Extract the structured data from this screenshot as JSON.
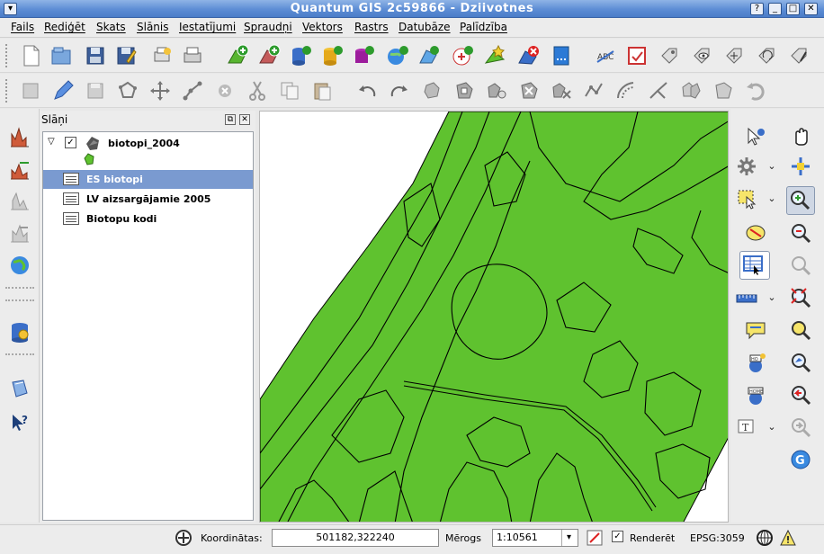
{
  "window": {
    "title": "Quantum GIS 2c59866 - Dziivotnes"
  },
  "menu": [
    "Fails",
    "Rediģēt",
    "Skats",
    "Slānis",
    "Iestatījumi",
    "Spraudņi",
    "Vektors",
    "Rastrs",
    "Datubāze",
    "Palīdzība"
  ],
  "layers_panel": {
    "title": "Slāņi",
    "items": [
      {
        "label": "biotopi_2004",
        "checked": true,
        "selected": false
      },
      {
        "label": "ES biotopi",
        "selected": true
      },
      {
        "label": "LV aizsargājamie 2005",
        "selected": false
      },
      {
        "label": "Biotopu kodi",
        "selected": false
      }
    ]
  },
  "status": {
    "coords_label": "Koordinātas:",
    "coords_value": "501182,322240",
    "scale_label": "Mērogs",
    "scale_value": "1:10561",
    "render_label": "Renderēt",
    "render_checked": true,
    "crs": "EPSG:3059"
  },
  "colors": {
    "map_fill": "#5fc22f",
    "selection": "#7a9ad0",
    "titlebar": "#5d8dd5"
  }
}
